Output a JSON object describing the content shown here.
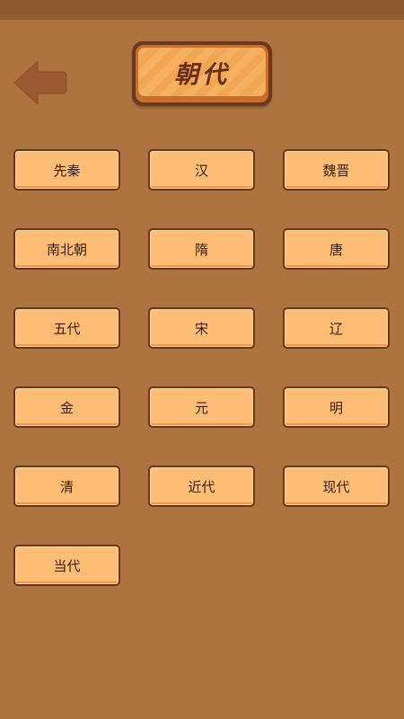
{
  "header": {
    "title": "朝代",
    "back_icon": "back-arrow-icon"
  },
  "colors": {
    "background": "#ad7442",
    "button_face": "#fdbd74",
    "button_border": "#6f3416",
    "title_text": "#6a2e12"
  },
  "dynasties": [
    {
      "label": "先秦"
    },
    {
      "label": "汉"
    },
    {
      "label": "魏晋"
    },
    {
      "label": "南北朝"
    },
    {
      "label": "隋"
    },
    {
      "label": "唐"
    },
    {
      "label": "五代"
    },
    {
      "label": "宋"
    },
    {
      "label": "辽"
    },
    {
      "label": "金"
    },
    {
      "label": "元"
    },
    {
      "label": "明"
    },
    {
      "label": "清"
    },
    {
      "label": "近代"
    },
    {
      "label": "现代"
    },
    {
      "label": "当代"
    }
  ]
}
